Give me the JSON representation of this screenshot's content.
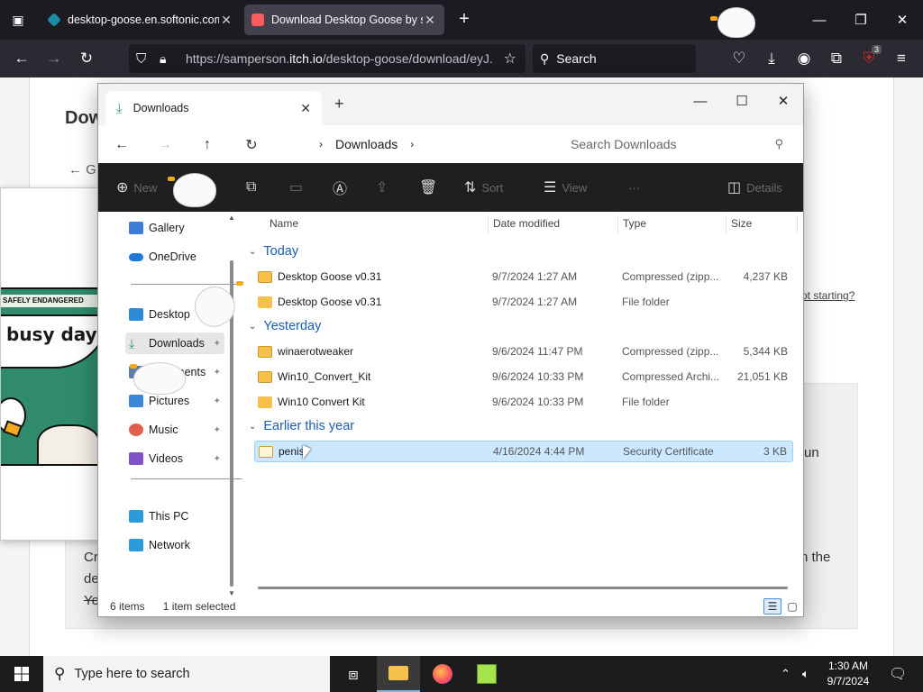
{
  "browser": {
    "tabs": [
      {
        "title": "desktop-goose.en.softonic.com",
        "active": false,
        "favicon_color": "#1a8ca7"
      },
      {
        "title": "Download Desktop Goose by samperson",
        "active": true,
        "favicon_color": "#fa5c5c"
      }
    ],
    "url_prefix": "https://samperson.",
    "url_domain": "itch.io",
    "url_suffix": "/desktop-goose/download/eyJ...",
    "search_placeholder": "Search",
    "extension_badge": "3"
  },
  "webpage": {
    "heading": "Dow",
    "back_text": "← G",
    "not_starting_link": "ot starting?",
    "frag_run": "un",
    "frag_cr": "Cr",
    "frag_de": "de",
    "frag_ye": "Ye",
    "frag_the": "n the"
  },
  "viewer": {
    "banner": "SAFELY ENDANGERED",
    "bubble_text": "busy day"
  },
  "explorer": {
    "tab_title": "Downloads",
    "breadcrumb": "Downloads",
    "search_placeholder": "Search Downloads",
    "toolbar": {
      "new": "New",
      "sort": "Sort",
      "view": "View",
      "more": "···",
      "details": "Details"
    },
    "sidebar": [
      {
        "label": "Gallery",
        "icon": "gallery-icon",
        "color": "#3b7dd8",
        "pinned": false
      },
      {
        "label": "OneDrive",
        "icon": "onedrive-icon",
        "color": "#1e78d4",
        "pinned": false
      },
      {
        "label": "Desktop",
        "icon": "desktop-icon",
        "color": "#2d8ad6",
        "pinned": true
      },
      {
        "label": "Downloads",
        "icon": "downloads-icon",
        "color": "#2e9e5b",
        "pinned": true,
        "active": true
      },
      {
        "label": "Documents",
        "icon": "documents-icon",
        "color": "#5c7fa8",
        "pinned": true
      },
      {
        "label": "Pictures",
        "icon": "pictures-icon",
        "color": "#3b88d6",
        "pinned": true
      },
      {
        "label": "Music",
        "icon": "music-icon",
        "color": "#e0604d",
        "pinned": true
      },
      {
        "label": "Videos",
        "icon": "videos-icon",
        "color": "#8152c8",
        "pinned": true
      },
      {
        "label": "This PC",
        "icon": "this-pc-icon",
        "color": "#2b9bd9",
        "pinned": false
      },
      {
        "label": "Network",
        "icon": "network-icon",
        "color": "#2b9bd9",
        "pinned": false
      }
    ],
    "columns": {
      "name": "Name",
      "date": "Date modified",
      "type": "Type",
      "size": "Size"
    },
    "groups": [
      {
        "label": "Today",
        "files": [
          {
            "name": "Desktop Goose v0.31",
            "date": "9/7/2024 1:27 AM",
            "type": "Compressed (zipp...",
            "size": "4,237 KB",
            "icon": "zip-folder-icon"
          },
          {
            "name": "Desktop Goose v0.31",
            "date": "9/7/2024 1:27 AM",
            "type": "File folder",
            "size": "",
            "icon": "folder-icon"
          }
        ]
      },
      {
        "label": "Yesterday",
        "files": [
          {
            "name": "winaerotweaker",
            "date": "9/6/2024 11:47 PM",
            "type": "Compressed (zipp...",
            "size": "5,344 KB",
            "icon": "zip-folder-icon"
          },
          {
            "name": "Win10_Convert_Kit",
            "date": "9/6/2024 10:33 PM",
            "type": "Compressed Archi...",
            "size": "21,051 KB",
            "icon": "zip-folder-icon"
          },
          {
            "name": "Win10 Convert Kit",
            "date": "9/6/2024 10:33 PM",
            "type": "File folder",
            "size": "",
            "icon": "folder-icon"
          }
        ]
      },
      {
        "label": "Earlier this year",
        "files": [
          {
            "name": "penis",
            "date": "4/16/2024 4:44 PM",
            "type": "Security Certificate",
            "size": "3 KB",
            "icon": "certificate-icon",
            "selected": true
          }
        ]
      }
    ],
    "status_items": "6 items",
    "status_selected": "1 item selected"
  },
  "taskbar": {
    "search_placeholder": "Type here to search",
    "time": "1:30 AM",
    "date": "9/7/2024"
  },
  "colors": {
    "folder": "#f5c14b",
    "selection": "#cce8ff",
    "accent_blue": "#1a5fb4"
  }
}
